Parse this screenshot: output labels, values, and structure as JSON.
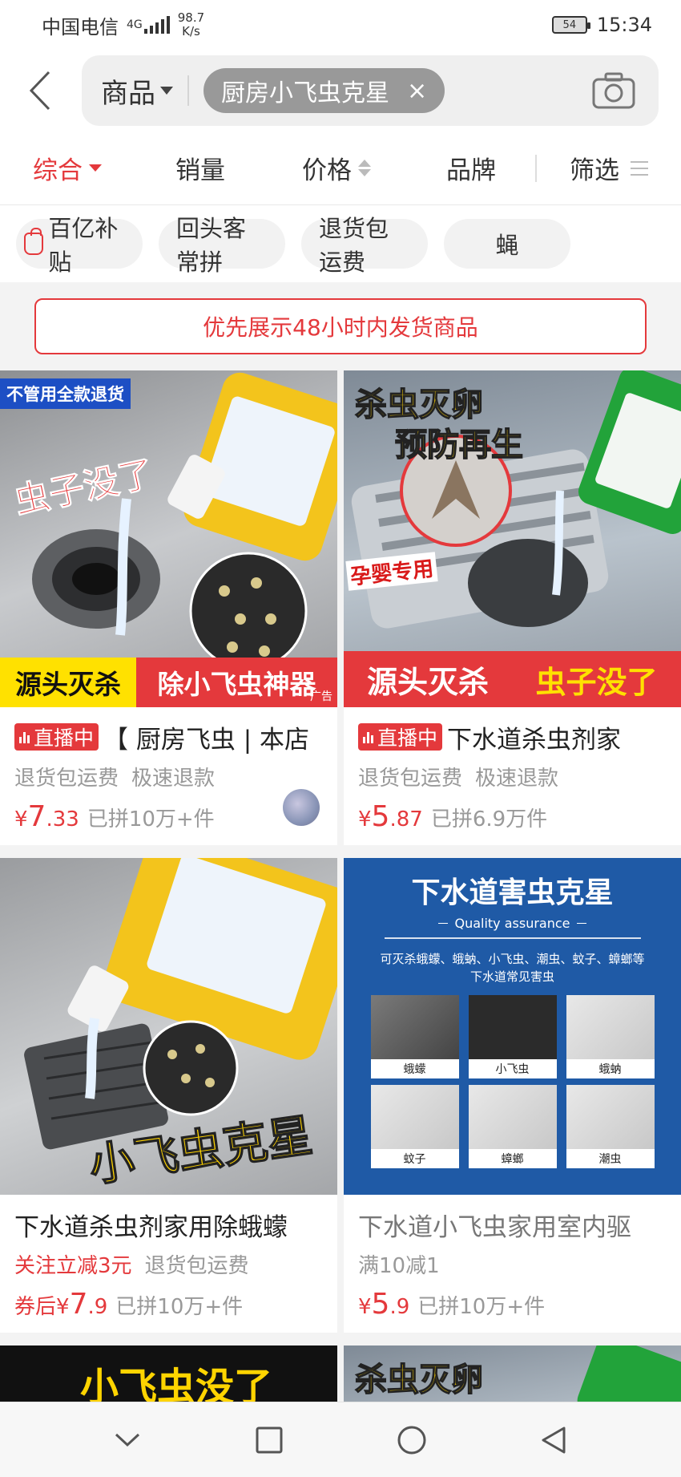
{
  "status": {
    "carrier": "中国电信",
    "network": "4G",
    "speed_value": "98.7",
    "speed_unit": "K/s",
    "battery": "54",
    "time": "15:34"
  },
  "search": {
    "scope": "商品",
    "query": "厨房小飞虫克星",
    "clear": "×"
  },
  "sort_tabs": [
    "综合",
    "销量",
    "价格",
    "品牌",
    "筛选"
  ],
  "filters": [
    "百亿补贴",
    "回头客常拼",
    "退货包运费",
    "蝇"
  ],
  "notice": "优先展示48小时内发货商品",
  "products": [
    {
      "live": "直播中",
      "title": "【 厨房飞虫 | 本店",
      "tags": [
        "退货包运费",
        "极速退款"
      ],
      "price_symbol": "¥",
      "price_int": "7",
      "price_dec": ".33",
      "sold": "已拼10万+件",
      "img": {
        "badge": "不管用全款退货",
        "slogan": "虫子没了",
        "strip_left": "源头灭杀",
        "strip_right": "除小飞虫神器",
        "ad": "广告"
      }
    },
    {
      "live": "直播中",
      "title": "下水道杀虫剂家",
      "tags": [
        "退货包运费",
        "极速退款"
      ],
      "price_symbol": "¥",
      "price_int": "5",
      "price_dec": ".87",
      "sold": "已拼6.9万件",
      "img": {
        "top1": "杀虫灭卵",
        "top2": "预防再生",
        "badge": "孕婴专用",
        "strip_left": "源头灭杀",
        "strip_right": "虫子没了"
      }
    },
    {
      "title": "下水道杀虫剂家用除蛾蠓",
      "promo": "关注立减3元",
      "tags": [
        "退货包运费"
      ],
      "price_prefix": "券后",
      "price_symbol": "¥",
      "price_int": "7",
      "price_dec": ".9",
      "sold": "已拼10万+件",
      "img": {
        "slogan": "小飞虫克星"
      }
    },
    {
      "title": "下水道小飞虫家用室内驱",
      "tags": [
        "满10减1"
      ],
      "price_symbol": "¥",
      "price_int": "5",
      "price_dec": ".9",
      "sold": "已拼10万+件",
      "img": {
        "heading": "下水道害虫克星",
        "sub": "Quality  assurance",
        "desc": "可灭杀蛾蠓、蛾蚋、小飞虫、潮虫、蚊子、蟑螂等下水道常见害虫",
        "labels": [
          "蛾蠓",
          "小飞虫",
          "蛾蚋",
          "蚊子",
          "蟑螂",
          "潮虫"
        ]
      }
    },
    {
      "img": {
        "slogan": "小飞虫没了"
      }
    },
    {
      "img": {
        "top1": "杀虫灭卵"
      }
    }
  ],
  "navbar": [
    "back",
    "home",
    "recents",
    "down"
  ]
}
